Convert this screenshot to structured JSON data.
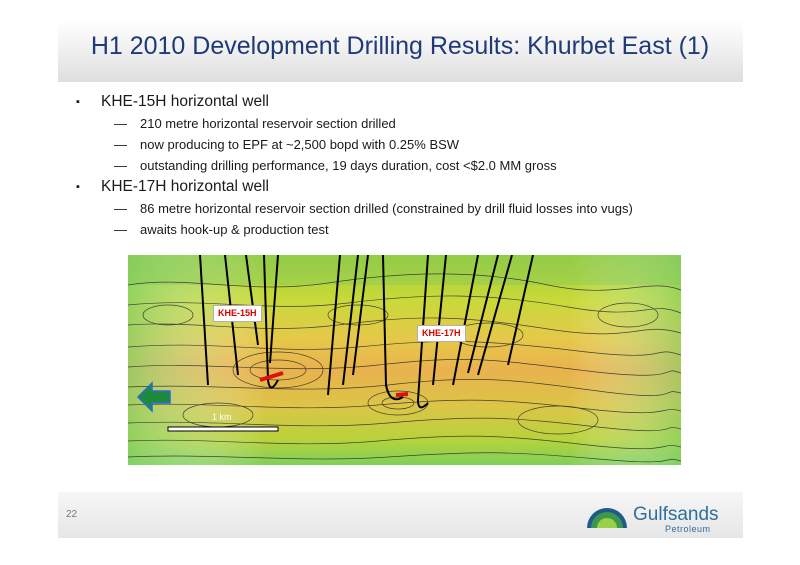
{
  "title": "H1 2010 Development Drilling Results: Khurbet East (1)",
  "bullets": [
    {
      "text": "KHE-15H horizontal well",
      "sub": [
        "210 metre horizontal reservoir section drilled",
        "now producing to EPF at ~2,500 bopd with 0.25% BSW",
        "outstanding drilling performance, 19 days duration, cost <$2.0 MM gross"
      ]
    },
    {
      "text": "KHE-17H horizontal well",
      "sub": [
        "86 metre horizontal reservoir section drilled (constrained by drill fluid losses into vugs)",
        "awaits hook-up & production test"
      ]
    }
  ],
  "bullet_mark": "▪",
  "dash_mark": "—",
  "map": {
    "labels": [
      "KHE-15H",
      "KHE-17H"
    ],
    "scale_label": "1 km",
    "arrow_icon": "left-arrow-icon"
  },
  "footer": {
    "page_number": "22",
    "logo_name": "Gulfsands",
    "logo_sub": "Petroleum"
  },
  "colors": {
    "title": "#1f3a78",
    "label_text": "#d40000",
    "arrow": "#1e8a3e",
    "logo": "#2f6f9f"
  }
}
